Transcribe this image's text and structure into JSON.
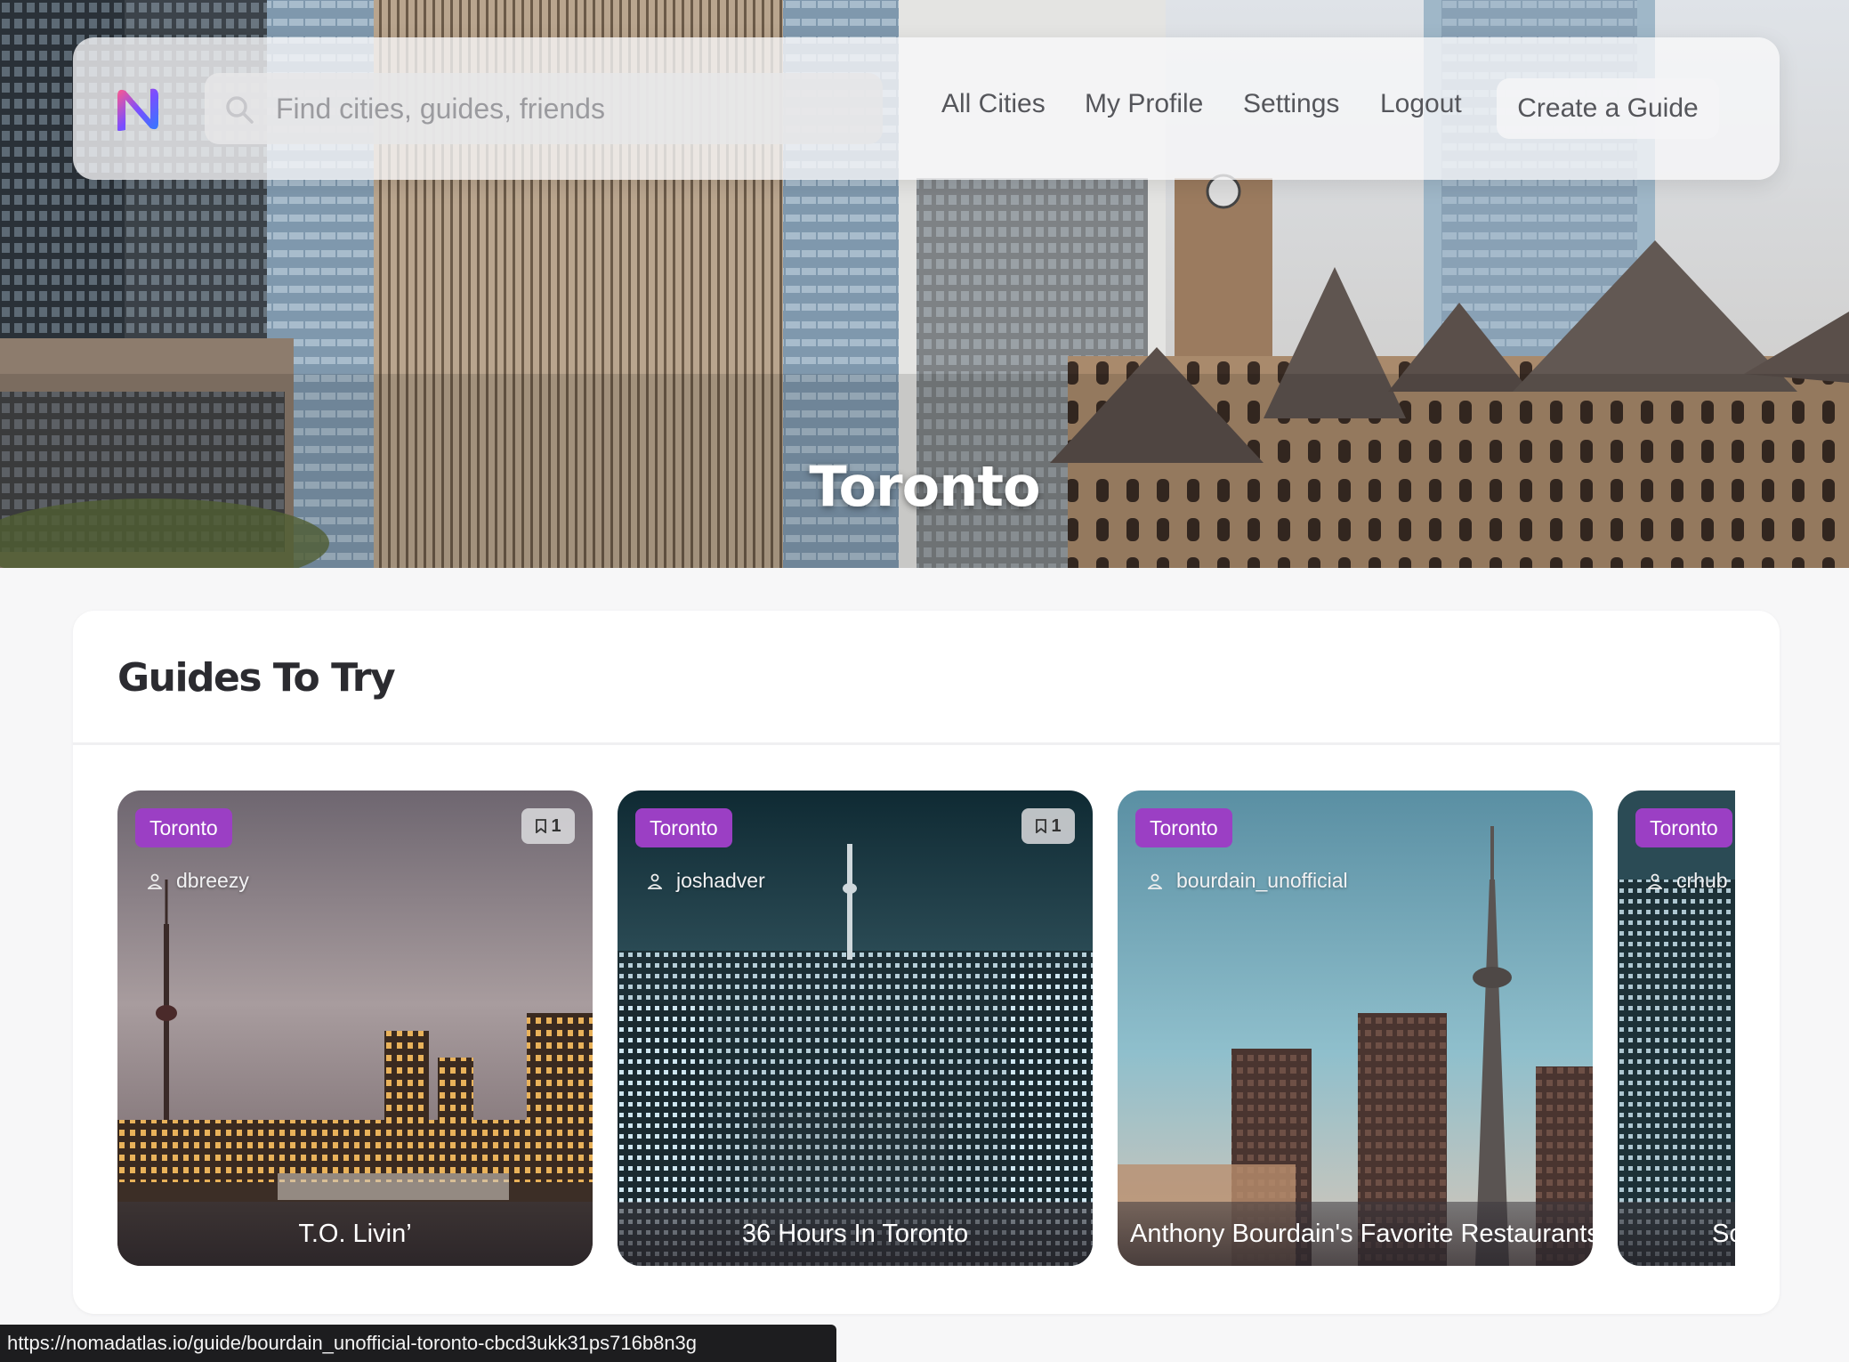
{
  "hero": {
    "city_name": "Toronto"
  },
  "nav": {
    "logo_icon": "nomad-atlas-logo",
    "search_placeholder": "Find cities, guides, friends",
    "links": {
      "all_cities": "All Cities",
      "my_profile": "My Profile",
      "settings": "Settings",
      "logout": "Logout"
    },
    "create_guide": "Create a Guide"
  },
  "guides": {
    "title": "Guides To Try",
    "cards": [
      {
        "city": "Toronto",
        "saves": "1",
        "author": "dbreezy",
        "title": "T.O. Livin’"
      },
      {
        "city": "Toronto",
        "saves": "1",
        "author": "joshadver",
        "title": "36 Hours In Toronto"
      },
      {
        "city": "Toronto",
        "author": "bourdain_unofficial",
        "title": "Anthony Bourdain's Favorite Restaurants"
      },
      {
        "city": "Toronto",
        "author": "crhub",
        "title": "So"
      }
    ]
  },
  "status_url": "https://nomadatlas.io/guide/bourdain_unofficial-toronto-cbcd3ukk31ps716b8n3g",
  "colors": {
    "badge": "#9b3fc4",
    "logo_gradient": [
      "#ff5a8a",
      "#7b4dff",
      "#2f7bff"
    ]
  }
}
